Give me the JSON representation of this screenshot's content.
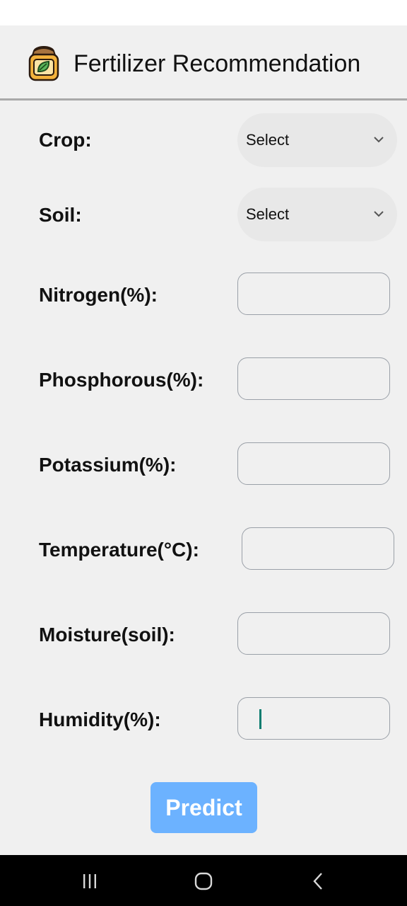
{
  "header": {
    "title": "Fertilizer Recommendation",
    "icon": "fertilizer-bag-icon"
  },
  "form": {
    "crop": {
      "label": "Crop:",
      "value": "Select"
    },
    "soil": {
      "label": "Soil:",
      "value": "Select"
    },
    "nitrogen": {
      "label": "Nitrogen(%):",
      "value": ""
    },
    "phosphorous": {
      "label": "Phosphorous(%):",
      "value": ""
    },
    "potassium": {
      "label": "Potassium(%):",
      "value": ""
    },
    "temperature": {
      "label": "Temperature(°C):",
      "value": ""
    },
    "moisture": {
      "label": "Moisture(soil):",
      "value": ""
    },
    "humidity": {
      "label": "Humidity(%):",
      "value": ""
    },
    "predict_label": "Predict"
  },
  "navbar": {
    "recent": "recent-apps-icon",
    "home": "home-icon",
    "back": "back-icon"
  },
  "colors": {
    "button": "#6cb2ff",
    "background": "#f0f0f0",
    "caret": "#0a7d70"
  }
}
